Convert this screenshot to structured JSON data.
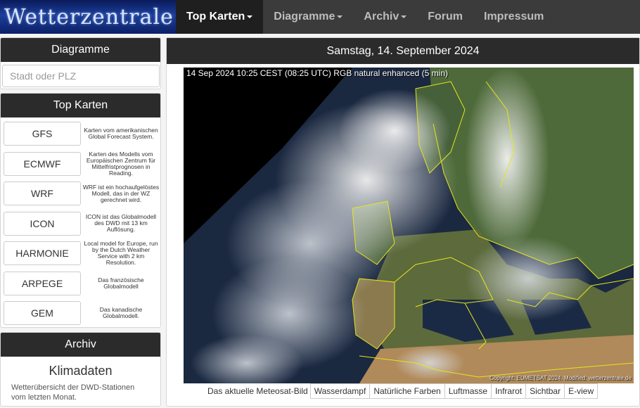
{
  "navbar": {
    "logo_text": "Wetterzentrale",
    "items": [
      {
        "label": "Top Karten",
        "dropdown": true,
        "active": true
      },
      {
        "label": "Diagramme",
        "dropdown": true
      },
      {
        "label": "Archiv",
        "dropdown": true
      },
      {
        "label": "Forum",
        "dropdown": false
      },
      {
        "label": "Impressum",
        "dropdown": false
      }
    ]
  },
  "sidebar": {
    "diagramme": {
      "title": "Diagramme",
      "search_placeholder": "Stadt oder PLZ"
    },
    "top_karten": {
      "title": "Top Karten",
      "models": [
        {
          "label": "GFS",
          "description": "Karten vom amerikanischen Global Forecast System."
        },
        {
          "label": "ECMWF",
          "description": "Karten des Modells vom Europäischen Zentrum für Mittelfristprognosen in Reading."
        },
        {
          "label": "WRF",
          "description": "WRF ist ein hochaufgelöstes Modell, das in der WZ gerechnet wird."
        },
        {
          "label": "ICON",
          "description": "ICON ist das Globalmodell des DWD mit 13 km Auflösung."
        },
        {
          "label": "HARMONIE",
          "description": "Local model for Europe, run by the Dutch Weather Service with 2 km Resolution."
        },
        {
          "label": "ARPEGE",
          "description": "Das französische Globalmodell"
        },
        {
          "label": "GEM",
          "description": "Das kanadische Globalmodell."
        }
      ]
    },
    "archiv": {
      "title": "Archiv",
      "klima_title": "Klimadaten",
      "klima_description": "Wetterübersicht der DWD-Stationen vom letzten Monat."
    }
  },
  "main": {
    "date": "Samstag, 14. September 2024",
    "satellite": {
      "caption": "14 Sep 2024 10:25 CEST (08:25 UTC) RGB natural enhanced (5 min)",
      "copyright": "Copyright: EUMETSAT 2024. Modified: wetterzentrale.de"
    },
    "tabs_label": "Das aktuelle Meteosat-Bild",
    "tabs": [
      "Wasserdampf",
      "Natürliche Farben",
      "Luftmasse",
      "Infrarot",
      "Sichtbar",
      "E-view"
    ]
  },
  "colors": {
    "navbar_bg": "#3b3b3b",
    "active_nav_bg": "#1f1f1f",
    "panel_header_bg": "#2b2b2b",
    "coastline": "#e5e61c"
  }
}
